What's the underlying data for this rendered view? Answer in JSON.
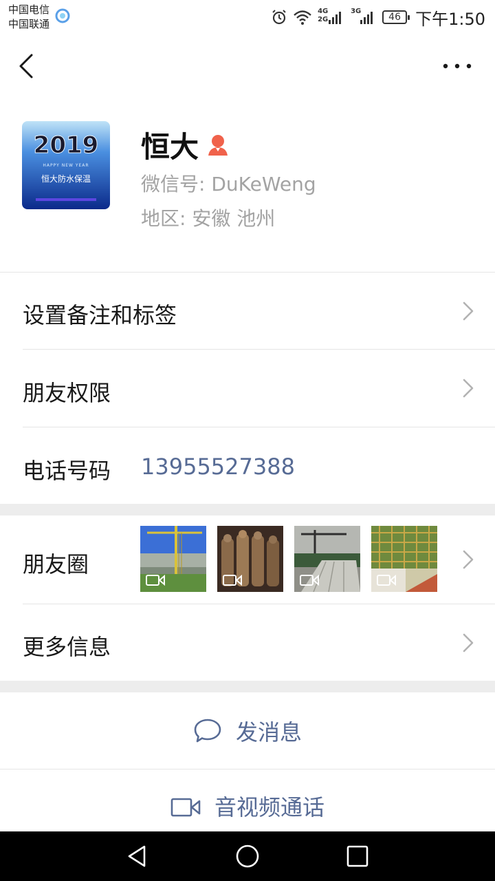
{
  "status_bar": {
    "carrier_1": "中国电信",
    "carrier_2": "中国联通",
    "network_1": "4G",
    "network_2": "2G",
    "network_3": "3G",
    "battery": "46",
    "time": "下午1:50"
  },
  "profile": {
    "name": "恒大",
    "avatar_year": "2019",
    "avatar_banner": "HAPPY NEW YEAR",
    "avatar_caption": "恒大防水保温",
    "wechat_id": "微信号: DuKeWeng",
    "region": "地区: 安徽  池州"
  },
  "rows": {
    "remark": "设置备注和标签",
    "permissions": "朋友权限",
    "phone_label": "电话号码",
    "phone_value": "13955527388",
    "moments": "朋友圈",
    "more_info": "更多信息"
  },
  "actions": {
    "send_message": "发消息",
    "video_call": "音视频通话"
  },
  "colors": {
    "link": "#576b95",
    "gender_icon": "#f0624b",
    "band": "#ededed"
  }
}
